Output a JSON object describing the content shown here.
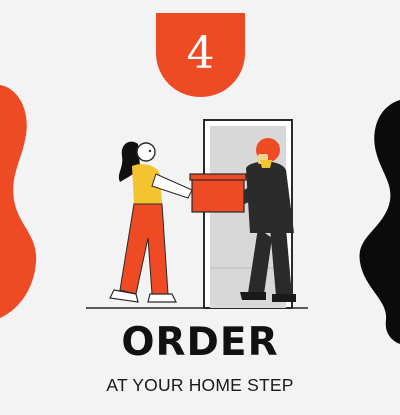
{
  "step": {
    "number": "4",
    "color": "#ee4a24"
  },
  "title": "ORDER",
  "subtitle": "AT YOUR HOME STEP",
  "colors": {
    "background": "#f3f3f3",
    "accent": "#ee4a24",
    "dark": "#111111",
    "yellow": "#f4c430"
  },
  "illustration": {
    "subject": "delivery-handoff-illustration",
    "elements": [
      "woman-receiving-icon",
      "courier-icon",
      "delivery-box-icon",
      "door-icon"
    ]
  }
}
